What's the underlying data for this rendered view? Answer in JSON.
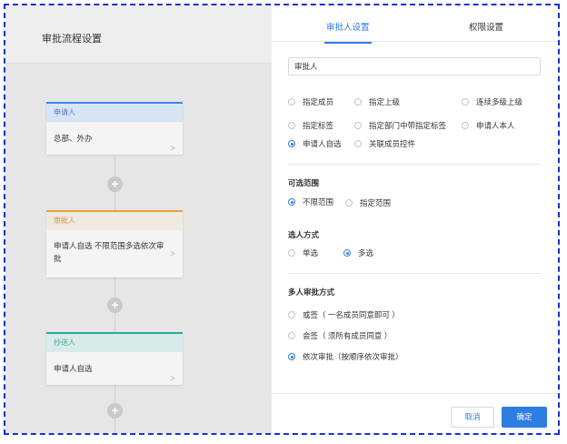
{
  "left": {
    "title": "审批流程设置",
    "cards": [
      {
        "head": "申请人",
        "body": "总部、外办",
        "color": "#3f86e0"
      },
      {
        "head": "审批人",
        "body": "申请人自选 不限范围多选依次审批",
        "color": "#e8a33a"
      },
      {
        "head": "抄送人",
        "body": "申请人自选",
        "color": "#2fa69a"
      }
    ]
  },
  "tabs": {
    "approver": "审批人设置",
    "permission": "权限设置"
  },
  "name_input": {
    "value": "审批人"
  },
  "approver_type": {
    "options": [
      "指定成员",
      "指定上级",
      "连续多级上级",
      "指定标签",
      "指定部门中带指定标签",
      "申请人本人",
      "申请人自选",
      "关联成员控件"
    ],
    "selected": "申请人自选"
  },
  "range": {
    "title": "可选范围",
    "options": [
      "不限范围",
      "指定范围"
    ],
    "selected": "不限范围"
  },
  "select_mode": {
    "title": "选人方式",
    "options": [
      "单选",
      "多选"
    ],
    "selected": "多选"
  },
  "multi_approval": {
    "title": "多人审批方式",
    "options": [
      "或签（ 一名成员同意即可 ）",
      "会签（ 须所有成员同意 ）",
      "依次审批（按顺序依次审批）"
    ],
    "selected": "依次审批（按顺序依次审批）"
  },
  "footer": {
    "cancel": "取消",
    "ok": "确定"
  },
  "colors": {
    "accent": "#2f7de1",
    "frame": "#1a2fd6"
  }
}
